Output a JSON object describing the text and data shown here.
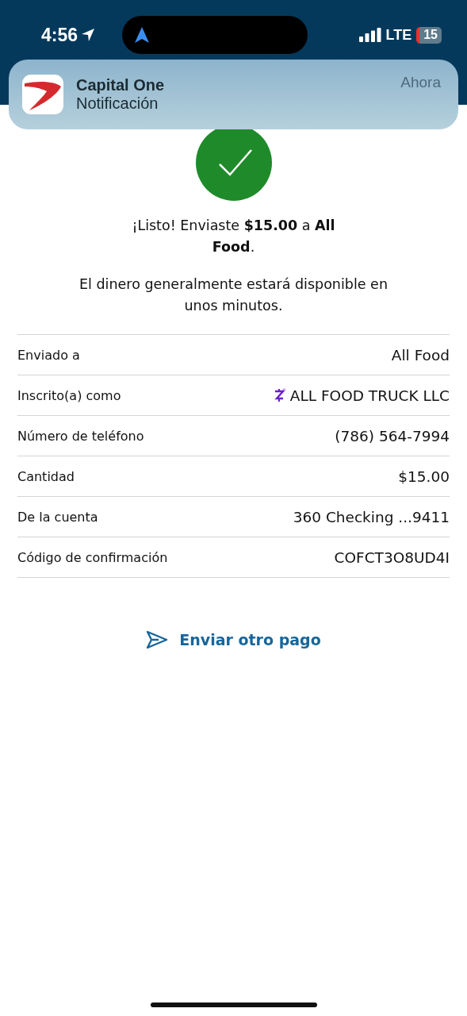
{
  "status_bar": {
    "time": "4:56",
    "network": "LTE",
    "battery": "15"
  },
  "notification": {
    "app": "Capital One",
    "text": "Notificación",
    "time": "Ahora"
  },
  "message": "¡Listo! Enviaste **$15.00** a **All Food**.",
  "note": "El dinero generalmente estará disponible en unos minutos.",
  "details": [
    {
      "label": "Enviado a",
      "value": "All Food"
    },
    {
      "label": "Inscrito(a) como",
      "value": "ALL FOOD TRUCK LLC",
      "kind": "zelle"
    },
    {
      "label": "Número de teléfono",
      "value": "(786) 564-7994"
    },
    {
      "label": "Cantidad",
      "value": "$15.00"
    },
    {
      "label": "De la cuenta",
      "value": "360 Checking ...9411"
    },
    {
      "label": "Código de confirmación",
      "value": "COFCT3O8UD4I"
    }
  ],
  "action": "Enviar otro pago"
}
